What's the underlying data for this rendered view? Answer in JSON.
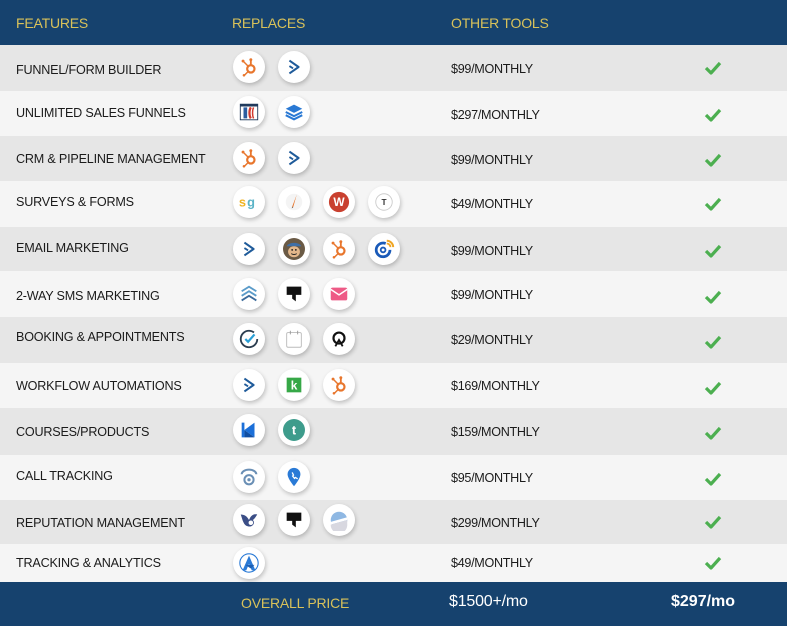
{
  "header": {
    "features": "FEATURES",
    "replaces": "REPLACES",
    "other_tools": "OTHER TOOLS"
  },
  "colors": {
    "header_bg": "#16426e",
    "header_text": "#d9c25a",
    "check": "#4caf50",
    "row_alt": "#e6e6e6",
    "row": "#f5f5f5"
  },
  "rows": [
    {
      "feature": "FUNNEL/FORM BUILDER",
      "price": "$99/MONTHLY",
      "included": true,
      "icons": [
        "hubspot-icon",
        "activecampaign-icon"
      ]
    },
    {
      "feature": "UNLIMITED SALES FUNNELS",
      "price": "$297/MONTHLY",
      "included": true,
      "icons": [
        "clickfunnels-icon",
        "leadpages-icon"
      ]
    },
    {
      "feature": "CRM & PIPELINE MANAGEMENT",
      "price": "$99/MONTHLY",
      "included": true,
      "icons": [
        "hubspot-icon",
        "activecampaign-icon"
      ]
    },
    {
      "feature": "SURVEYS & FORMS",
      "price": "$49/MONTHLY",
      "included": true,
      "icons": [
        "surveygizmo-icon",
        "pencil-icon",
        "wufoo-icon",
        "typeform-icon"
      ]
    },
    {
      "feature": "EMAIL MARKETING",
      "price": "$99/MONTHLY",
      "included": true,
      "icons": [
        "activecampaign-icon",
        "mailchimp-icon",
        "hubspot-icon",
        "constant-contact-icon"
      ]
    },
    {
      "feature": "2-WAY SMS MARKETING",
      "price": "$99/MONTHLY",
      "included": true,
      "icons": [
        "chevrons-up-icon",
        "podium-icon",
        "envelope-icon"
      ]
    },
    {
      "feature": "BOOKING & APPOINTMENTS",
      "price": "$29/MONTHLY",
      "included": true,
      "icons": [
        "check-circle-icon",
        "calendar-icon",
        "acuity-icon"
      ]
    },
    {
      "feature": "WORKFLOW AUTOMATIONS",
      "price": "$169/MONTHLY",
      "included": true,
      "icons": [
        "activecampaign-icon",
        "keap-icon",
        "hubspot-icon"
      ]
    },
    {
      "feature": "COURSES/PRODUCTS",
      "price": "$159/MONTHLY",
      "included": true,
      "icons": [
        "kajabi-icon",
        "teachable-icon"
      ]
    },
    {
      "feature": "CALL TRACKING",
      "price": "$95/MONTHLY",
      "included": true,
      "icons": [
        "phone-ring-icon",
        "phone-pin-icon"
      ]
    },
    {
      "feature": "REPUTATION MANAGEMENT",
      "price": "$299/MONTHLY",
      "included": true,
      "icons": [
        "birdeye-icon",
        "podium-icon",
        "grade-us-icon"
      ]
    },
    {
      "feature": "TRACKING & ANALYTICS",
      "price": "$49/MONTHLY",
      "included": true,
      "icons": [
        "analytics-a-icon"
      ]
    }
  ],
  "footer": {
    "label": "OVERALL PRICE",
    "other_total": "$1500+/mo",
    "our_price": "$297/mo"
  }
}
